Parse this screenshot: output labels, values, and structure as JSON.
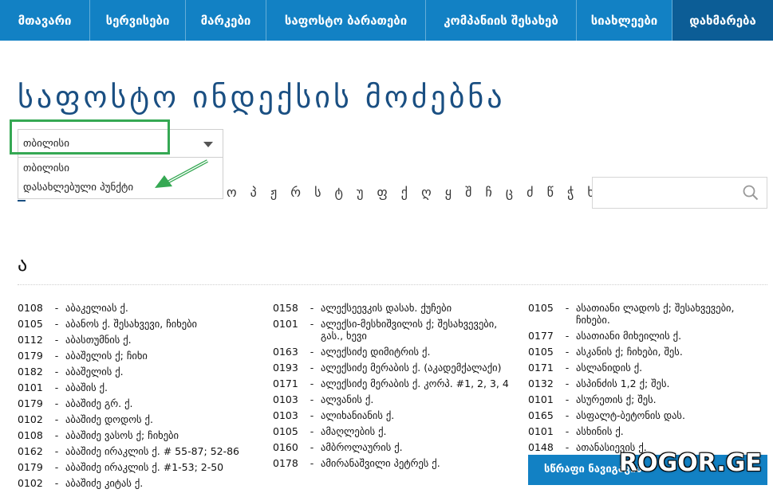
{
  "nav": {
    "items": [
      {
        "label": "მთავარი"
      },
      {
        "label": "სერვისები"
      },
      {
        "label": "მარკები"
      },
      {
        "label": "საფოსტო ბარათები"
      },
      {
        "label": "კომპანიის შესახებ"
      },
      {
        "label": "სიახლეები"
      },
      {
        "label": "დახმარება"
      }
    ]
  },
  "page": {
    "title": "საფოსტო ინდექსის მოძებნა"
  },
  "city_select": {
    "value": "თბილისი",
    "options": [
      "თბილისი",
      "დასახლებული პუნქტი"
    ]
  },
  "alphabet": "ო პ ჟ რ ს ტ უ ფ ქ ღ ყ შ ჩ ც ძ წ ჭ ხ ჯ ჰ",
  "search": {
    "placeholder": ""
  },
  "current_letter": "ა",
  "columns": [
    [
      {
        "code": "0108",
        "name": "აბაკელიას ქ."
      },
      {
        "code": "0105",
        "name": "აბანოს ქ. შესახვევი, ჩიხები"
      },
      {
        "code": "0112",
        "name": "აბასთუმნის ქ."
      },
      {
        "code": "0179",
        "name": "აბაშელის ქ; ჩიხი"
      },
      {
        "code": "0182",
        "name": "აბაშელის ქ."
      },
      {
        "code": "0101",
        "name": "აბაშის ქ."
      },
      {
        "code": "0179",
        "name": "აბაშიძე გრ. ქ."
      },
      {
        "code": "0102",
        "name": "აბაშიძე დოდოს ქ."
      },
      {
        "code": "0108",
        "name": "აბაშიძე ვასოს ქ; ჩიხები"
      },
      {
        "code": "0162",
        "name": "აბაშიძე ირაკლის ქ. # 55-87; 52-86"
      },
      {
        "code": "0179",
        "name": "აბაშიძე ირაკლის ქ. #1-53; 2-50"
      },
      {
        "code": "0102",
        "name": "აბაშიძე კიტას ქ."
      }
    ],
    [
      {
        "code": "0158",
        "name": "ალექსეევკის დასახ. ქუჩები"
      },
      {
        "code": "0101",
        "name": "ალექსი-მესხიშვილის ქ; შესახვევები, გას., ხევი"
      },
      {
        "code": "0163",
        "name": "ალექსიძე დიმიტრის ქ."
      },
      {
        "code": "0193",
        "name": "ალექსიძე მერაბის ქ. (აკადემქალაქი)"
      },
      {
        "code": "0171",
        "name": "ალექსიძე მერაბის ქ. კორპ. #1, 2, 3, 4"
      },
      {
        "code": "0103",
        "name": "ალვანის ქ."
      },
      {
        "code": "0103",
        "name": "ალიხანიანის ქ."
      },
      {
        "code": "0105",
        "name": "ამაღლების ქ."
      },
      {
        "code": "0160",
        "name": "ამბროლაურის ქ."
      },
      {
        "code": "0178",
        "name": "ამირანაშვილი პეტრეს ქ."
      }
    ],
    [
      {
        "code": "0105",
        "name": "ასათიანი ლადოს ქ; შესახვევები, ჩიხები."
      },
      {
        "code": "0177",
        "name": "ასათიანი მიხეილის ქ."
      },
      {
        "code": "0105",
        "name": "ასკანის ქ; ჩიხები, შეს."
      },
      {
        "code": "0171",
        "name": "ასლანიდის ქ."
      },
      {
        "code": "0132",
        "name": "ასპინძის 1,2 ქ; შეს."
      },
      {
        "code": "0101",
        "name": "ასურეთის ქ; შეს."
      },
      {
        "code": "0165",
        "name": "ასფალტ-ბეტონის დას."
      },
      {
        "code": "0101",
        "name": "ასხინის ქ."
      },
      {
        "code": "0148",
        "name": "ათანასიევის ქ."
      }
    ]
  ],
  "sticky_button": {
    "label": "სწრაფი ნავიგაცია"
  },
  "watermark": "ROGOR.GE",
  "colors": {
    "nav": "#1281c4",
    "nav_active": "#0c5d96",
    "title": "#1a4f82",
    "highlight": "#35a853"
  }
}
